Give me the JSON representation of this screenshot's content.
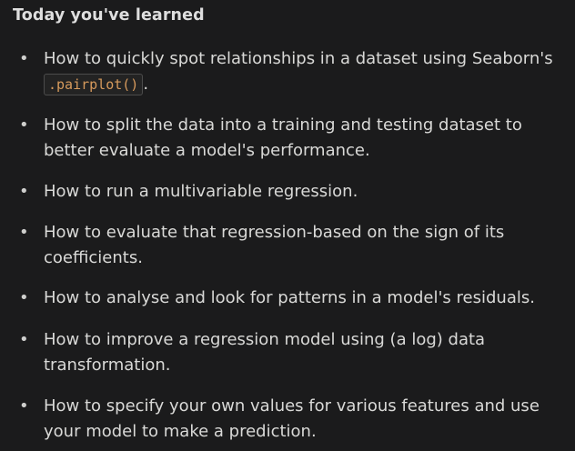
{
  "title": "Today you've learned",
  "items": [
    {
      "text": "How to quickly spot relationships in a dataset using Seaborn's",
      "code": ".pairplot()",
      "suffix": "."
    },
    {
      "text": "How to split the data into a training and testing dataset to better evaluate a model's performance."
    },
    {
      "text": "How to run a multivariable regression."
    },
    {
      "text": "How to evaluate that regression-based on the sign of its coefficients."
    },
    {
      "text": "How to analyse and look for patterns in a model's residuals."
    },
    {
      "text": "How to improve a regression model using (a log) data transformation."
    },
    {
      "text": "How to specify your own values for various features and use your model to make a prediction."
    }
  ],
  "bullet_glyph": "•",
  "colors": {
    "background": "#1b1b1c",
    "text": "#d9d9d7",
    "code_text": "#d69a5c",
    "code_border": "#4b4b4b"
  }
}
